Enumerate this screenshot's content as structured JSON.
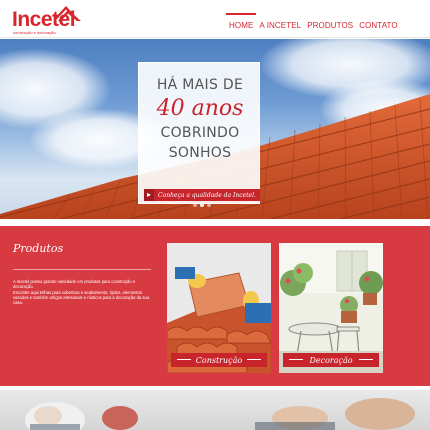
{
  "header": {
    "logo_text": "Incetel",
    "logo_tagline": "construção e decoração",
    "nav": [
      {
        "label": "HOME",
        "active": true
      },
      {
        "label": "A INCETEL",
        "active": false
      },
      {
        "label": "PRODUTOS",
        "active": false
      },
      {
        "label": "CONTATO",
        "active": false
      }
    ]
  },
  "hero": {
    "line1": "HÁ MAIS DE",
    "line2": "40 anos",
    "line3": "COBRINDO",
    "line4": "SONHOS",
    "cta_label": "Conheça a qualidade da Incetel.",
    "cta_icon": "arrow-right-icon",
    "slides": 3,
    "active_slide": 2
  },
  "products": {
    "title": "Produtos",
    "desc_1": "A Incetel possui grande variedade em produtos para construção e decoração.",
    "desc_2": "Encontre aqui telhas para cobertura e acabamento, tijolos, elementos vazados e também artigos artesanais e rústicos para a decoração da sua casa.",
    "cards": [
      {
        "label": "Construção"
      },
      {
        "label": "Decoração"
      }
    ]
  },
  "colors": {
    "brand_red": "#d7262e",
    "section_red": "#d83a41",
    "label_red": "#c8242c"
  }
}
